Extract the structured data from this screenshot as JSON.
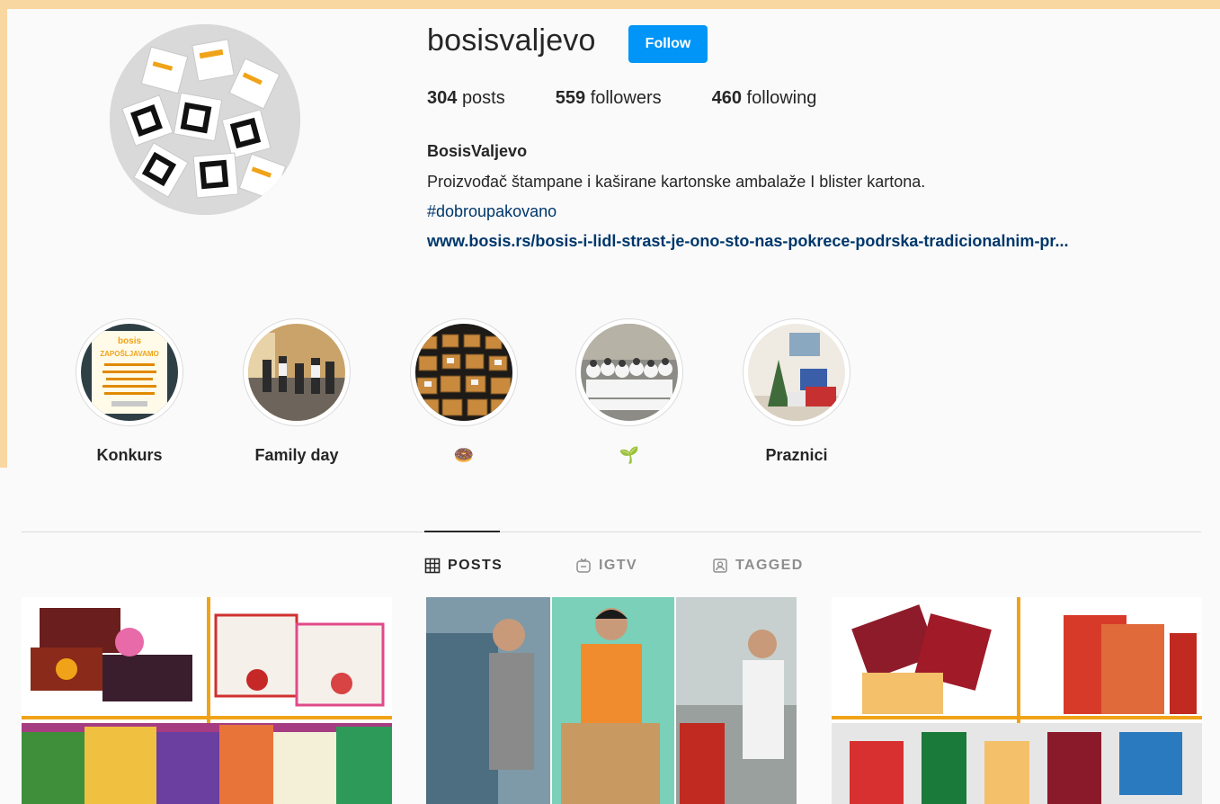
{
  "profile": {
    "username": "bosisvaljevo",
    "follow_label": "Follow",
    "stats": {
      "posts_count": "304",
      "posts_label": "posts",
      "followers_count": "559",
      "followers_label": "followers",
      "following_count": "460",
      "following_label": "following"
    },
    "bio": {
      "name": "BosisValjevo",
      "text": "Proizvođač štampane i kaširane kartonske ambalaže I blister kartona.",
      "hashtag": "#dobroupakovano",
      "link": "www.bosis.rs/bosis-i-lidl-strast-je-ono-sto-nas-pokrece-podrska-tradicionalnim-pr..."
    }
  },
  "highlights": [
    {
      "label": "Konkurs"
    },
    {
      "label": "Family day"
    },
    {
      "label": "🍩"
    },
    {
      "label": "🌱"
    },
    {
      "label": "Praznici"
    }
  ],
  "highlight_thumb_text": {
    "logo": "bosis",
    "headline": "ZAPOŠLJAVAMO"
  },
  "tabs": [
    {
      "label": "POSTS",
      "icon": "grid-icon",
      "active": true
    },
    {
      "label": "IGTV",
      "icon": "igtv-icon",
      "active": false
    },
    {
      "label": "TAGGED",
      "icon": "tagged-icon",
      "active": false
    }
  ],
  "posts": [
    {
      "alt_icon": "tea-packaging-collage"
    },
    {
      "alt_icon": "factory-workers-collage"
    },
    {
      "alt_icon": "boxes-collage"
    }
  ],
  "colors": {
    "accent": "#0095f6",
    "link": "#00376b",
    "frame": "#f8d7a0"
  }
}
